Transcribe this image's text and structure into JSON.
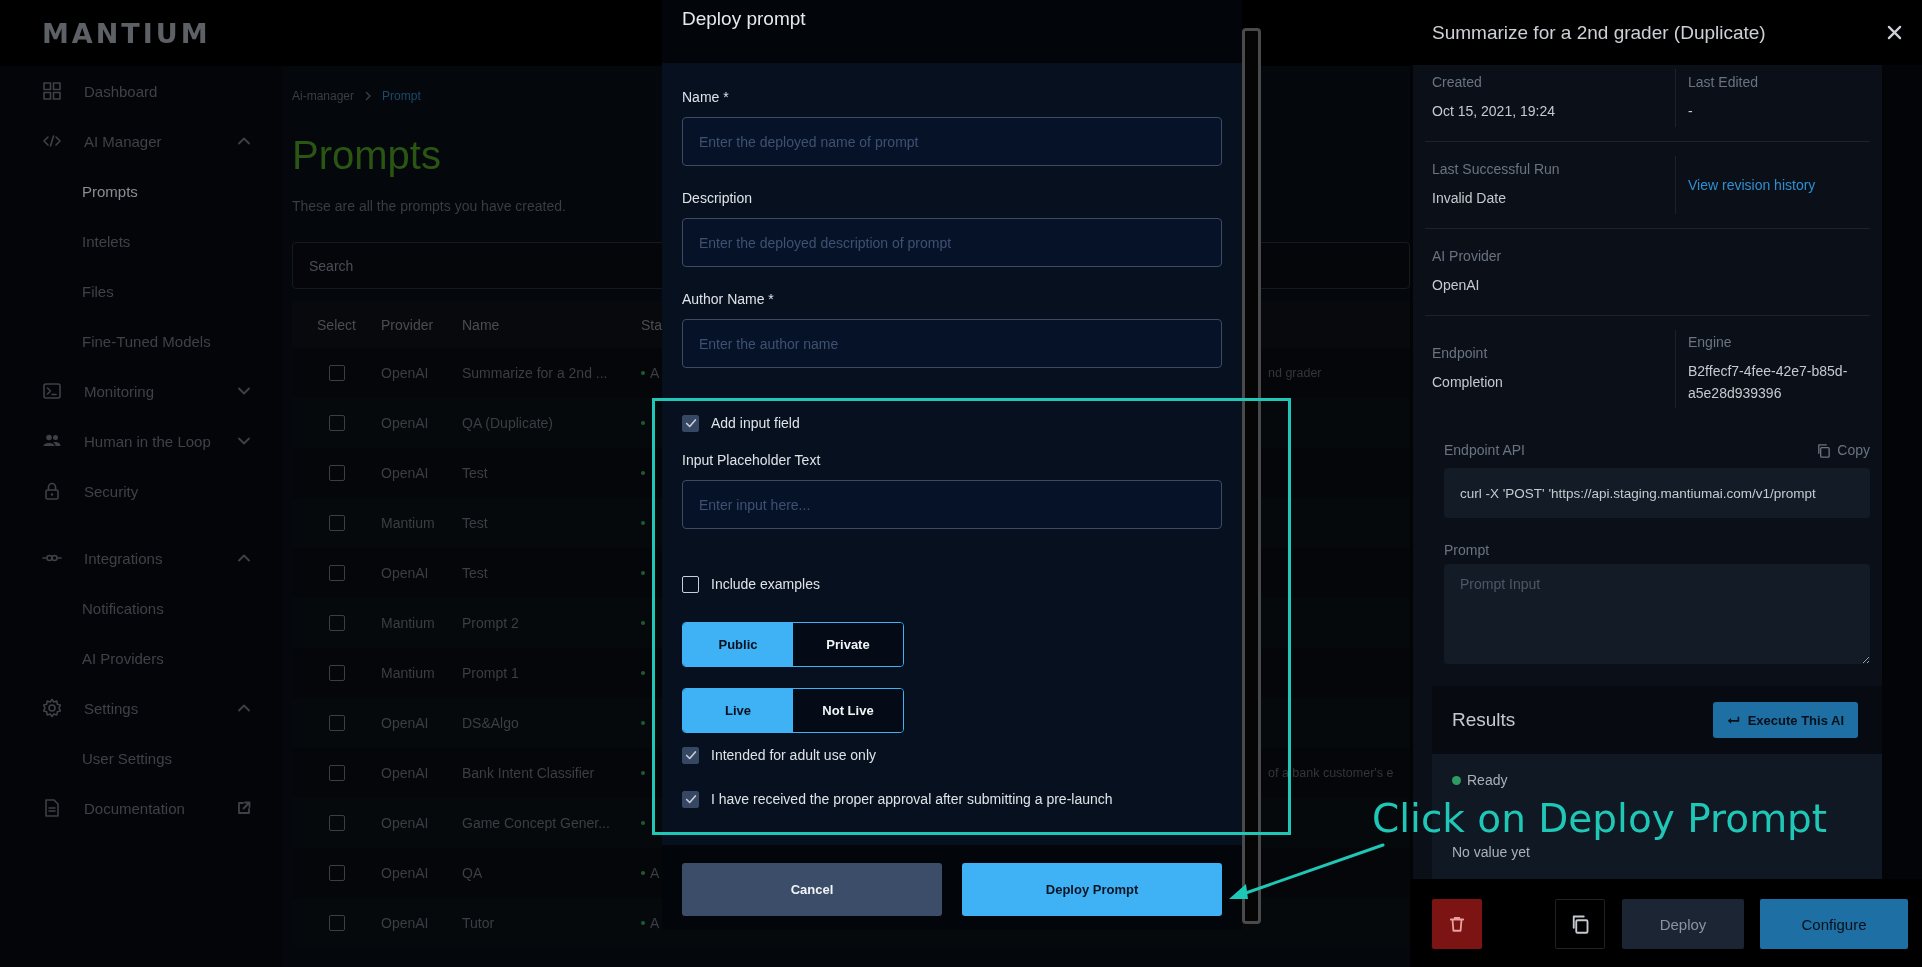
{
  "sidebar": {
    "logo": "MANTIUM",
    "sections": [
      {
        "items": [
          {
            "label": "Dashboard",
            "selected": false
          },
          {
            "label": "AI Manager",
            "selected": false,
            "expanded": true,
            "children": [
              {
                "label": "Prompts",
                "selected": true
              },
              {
                "label": "Intelets",
                "selected": false
              },
              {
                "label": "Files",
                "selected": false
              },
              {
                "label": "Fine-Tuned Models",
                "selected": false
              }
            ]
          },
          {
            "label": "Monitoring",
            "selected": false,
            "expanded": false
          },
          {
            "label": "Human in the Loop",
            "selected": false,
            "expanded": false
          },
          {
            "label": "Security",
            "selected": false
          }
        ]
      },
      {
        "items": [
          {
            "label": "Integrations",
            "selected": false,
            "expanded": true,
            "children": [
              {
                "label": "Notifications",
                "selected": false
              },
              {
                "label": "AI Providers",
                "selected": false
              }
            ]
          },
          {
            "label": "Settings",
            "selected": false,
            "expanded": true,
            "children": [
              {
                "label": "User Settings",
                "selected": false
              }
            ]
          },
          {
            "label": "Documentation",
            "selected": false,
            "external": true
          }
        ]
      }
    ]
  },
  "breadcrumb": [
    "Ai-manager",
    "Prompt"
  ],
  "page": {
    "title": "Prompts",
    "subtitle": "These are all the prompts you have created.",
    "search": {
      "placeholder": "Search"
    }
  },
  "table": {
    "columns": [
      "Select",
      "Provider",
      "Name",
      "Sta"
    ],
    "rows": [
      {
        "checked": false,
        "provider": "OpenAI",
        "name": "Summarize for a 2nd ...",
        "status": "A",
        "description": "nd grader"
      },
      {
        "checked": false,
        "provider": "OpenAI",
        "name": "QA (Duplicate)"
      },
      {
        "checked": false,
        "provider": "OpenAI",
        "name": "Test"
      },
      {
        "checked": false,
        "provider": "Mantium",
        "name": "Test"
      },
      {
        "checked": false,
        "provider": "OpenAI",
        "name": "Test"
      },
      {
        "checked": false,
        "provider": "Mantium",
        "name": "Prompt 2"
      },
      {
        "checked": false,
        "provider": "Mantium",
        "name": "Prompt 1"
      },
      {
        "checked": false,
        "provider": "OpenAI",
        "name": "DS&Algo"
      },
      {
        "checked": false,
        "provider": "OpenAI",
        "name": "Bank Intent Classifier",
        "description": "of a bank customer's e"
      },
      {
        "checked": false,
        "provider": "OpenAI",
        "name": "Game Concept Gener..."
      },
      {
        "checked": false,
        "provider": "OpenAI",
        "name": "QA",
        "status": "A"
      },
      {
        "checked": false,
        "provider": "OpenAI",
        "name": "Tutor",
        "status": "A"
      }
    ]
  },
  "modal": {
    "title": "Deploy prompt",
    "items": [
      {
        "kind": "field",
        "label": "Name *",
        "placeholder": "Enter the deployed name of prompt"
      },
      {
        "kind": "field",
        "label": "Description",
        "placeholder": "Enter the deployed description of prompt"
      },
      {
        "kind": "field",
        "label": "Author Name *",
        "placeholder": "Enter the author name"
      },
      {
        "kind": "checkbox",
        "label": "Add input field",
        "checked": true
      },
      {
        "kind": "field",
        "label": "Input Placeholder Text",
        "placeholder": "Enter input here..."
      },
      {
        "kind": "checkbox",
        "label": "Include examples",
        "checked": false
      },
      {
        "kind": "segmented",
        "options": [
          {
            "label": "Public",
            "selected": true
          },
          {
            "label": "Private",
            "selected": false
          }
        ]
      },
      {
        "kind": "segmented",
        "options": [
          {
            "label": "Live",
            "selected": true
          },
          {
            "label": "Not Live",
            "selected": false
          }
        ]
      },
      {
        "kind": "checkbox",
        "label": "Intended for adult use only",
        "checked": true
      },
      {
        "kind": "checkbox",
        "label": "I have received the proper approval after submitting a pre-launch",
        "checked": true
      }
    ],
    "buttons": [
      {
        "label": "Cancel",
        "kind": "secondary"
      },
      {
        "label": "Deploy Prompt",
        "kind": "primary"
      }
    ]
  },
  "panel": {
    "title": "Summarize for a 2nd grader (Duplicate)",
    "info_rows": [
      {
        "cells": [
          {
            "label": "Created",
            "value": "Oct 15, 2021, 19:24"
          },
          {
            "label": "Last Edited",
            "value": "-"
          }
        ]
      },
      {
        "cells": [
          {
            "label": "Last Successful Run",
            "value": "Invalid Date"
          },
          {
            "link": "View revision history"
          }
        ]
      },
      {
        "cells": [
          {
            "label": "AI Provider",
            "value": "OpenAI"
          }
        ]
      },
      {
        "cells": [
          {
            "label": "Endpoint",
            "value": "Completion"
          },
          {
            "label": "Engine",
            "value": "B2ffecf7-4fee-42e7-b85d-a5e28d939396"
          }
        ]
      }
    ],
    "endpoint_api": {
      "label": "Endpoint API",
      "copy": "Copy",
      "value": "curl -X 'POST' 'https://api.staging.mantiumai.com/v1/prompt"
    },
    "prompt": {
      "label": "Prompt",
      "placeholder": "Prompt Input"
    },
    "results": {
      "title": "Results",
      "execute": "Execute This AI",
      "status": "Ready",
      "value": "No value yet"
    },
    "footer": {
      "deploy": "Deploy",
      "configure": "Configure"
    }
  },
  "annotation": {
    "text": "Click on Deploy Prompt"
  }
}
